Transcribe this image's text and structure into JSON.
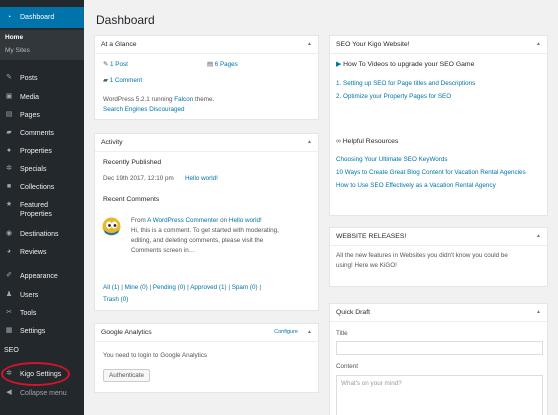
{
  "sidebar": {
    "dashboard": "Dashboard",
    "home": "Home",
    "my_sites": "My Sites",
    "items": [
      {
        "label": "Posts",
        "icon": "pin-icon"
      },
      {
        "label": "Media",
        "icon": "media-icon"
      },
      {
        "label": "Pages",
        "icon": "pages-icon"
      },
      {
        "label": "Comments",
        "icon": "comments-icon"
      },
      {
        "label": "Properties",
        "icon": "location-icon"
      },
      {
        "label": "Specials",
        "icon": "gear-icon"
      },
      {
        "label": "Collections",
        "icon": "folder-icon"
      },
      {
        "label": "Featured Properties",
        "icon": "star-icon"
      },
      {
        "label": "Destinations",
        "icon": "globe-icon"
      },
      {
        "label": "Reviews",
        "icon": "reviews-icon"
      },
      {
        "label": "Appearance",
        "icon": "brush-icon"
      },
      {
        "label": "Users",
        "icon": "users-icon"
      },
      {
        "label": "Tools",
        "icon": "wrench-icon"
      },
      {
        "label": "Settings",
        "icon": "settings-icon"
      },
      {
        "label": "SEO",
        "icon": "seo-icon"
      },
      {
        "label": "Kigo Settings",
        "icon": "gear-icon"
      }
    ],
    "collapse": "Collapse menu",
    "highlight_color": "#d2152a"
  },
  "page_title": "Dashboard",
  "at_a_glance": {
    "title": "At a Glance",
    "posts": "1 Post",
    "pages": "6 Pages",
    "comments": "1 Comment",
    "wp_version": "WordPress 5.2.1 running",
    "theme": "Falcon",
    "theme_suffix": "theme.",
    "search_engines": "Search Engines Discouraged"
  },
  "activity": {
    "title": "Activity",
    "recently_published": "Recently Published",
    "pub_date": "Dec 19th 2017, 12:10 pm",
    "pub_link": "Hello world!",
    "recent_comments": "Recent Comments",
    "comment_from": "From",
    "comment_author": "A WordPress Commenter",
    "comment_on": "on",
    "comment_post": "Hello world!",
    "comment_lines": [
      "Hi, this is a comment. To get started with moderating,",
      "editing, and deleting comments, please visit the",
      "Comments screen in…"
    ],
    "filters": [
      {
        "label": "All (1)",
        "sep": "|"
      },
      {
        "label": "Mine (0)",
        "sep": "|"
      },
      {
        "label": "Pending (0)",
        "sep": "|"
      },
      {
        "label": "Approved (1)",
        "sep": "|"
      },
      {
        "label": "Spam (0)",
        "sep": "|"
      },
      {
        "label": "Trash (0)",
        "sep": ""
      }
    ]
  },
  "analytics": {
    "title": "Google Analytics",
    "configure": "Configure",
    "message": "You need to login to Google Analytics",
    "button": "Authenticate"
  },
  "seo": {
    "title": "SEO Your Kigo Website!",
    "video_heading": "How To Videos to upgrade your SEO Game",
    "videos": [
      "1. Setting up SEO for Page titles and Descriptions",
      "2. Optimize your Property Pages for SEO"
    ],
    "resources_heading": "Helpful Resources",
    "resources": [
      "Choosing Your Ultimate SEO KeyWords",
      "10 Ways to Create Great Blog Content for Vacation Rental Agencies",
      "How to Use SEO Effectively as a Vacation Rental Agency"
    ]
  },
  "releases": {
    "title": "WEBSITE RELEASES!",
    "text_lines": [
      "All the new features in Websites you didn't know you could be",
      "using! Here we KiGO!"
    ]
  },
  "quick_draft": {
    "title": "Quick Draft",
    "title_label": "Title",
    "content_label": "Content",
    "content_placeholder": "What's on your mind?"
  },
  "colors": {
    "accent": "#0073aa",
    "sidebar_bg": "#23282d",
    "page_bg": "#f1f1f1"
  }
}
